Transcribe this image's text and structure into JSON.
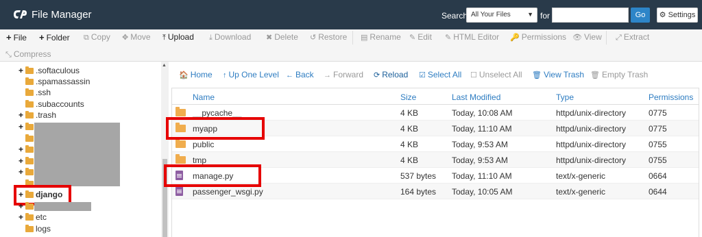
{
  "header": {
    "app_title": "File Manager",
    "search_label": "Search",
    "search_scope": "All Your Files",
    "for_label": "for",
    "search_value": "",
    "go_label": "Go",
    "settings_label": "Settings"
  },
  "toolbar": {
    "items": [
      {
        "label": "File",
        "icon": "+"
      },
      {
        "label": "Folder",
        "icon": "+"
      },
      {
        "label": "Copy",
        "icon": "⧉"
      },
      {
        "label": "Move",
        "icon": "✥"
      },
      {
        "label": "Upload",
        "icon": "⤒"
      },
      {
        "label": "Download",
        "icon": "⤓"
      },
      {
        "label": "Delete",
        "icon": "✖"
      },
      {
        "label": "Restore",
        "icon": "↺"
      },
      {
        "label": "Rename",
        "icon": "▤"
      },
      {
        "label": "Edit",
        "icon": "✎"
      },
      {
        "label": "HTML Editor",
        "icon": "✎"
      },
      {
        "label": "Permissions",
        "icon": "🔑"
      },
      {
        "label": "View",
        "icon": "👁"
      },
      {
        "label": "Extract",
        "icon": "⤢"
      },
      {
        "label": "Compress",
        "icon": "⤡"
      }
    ]
  },
  "tree": {
    "items": [
      {
        "label": ".softaculous"
      },
      {
        "label": ".spamassassin"
      },
      {
        "label": ".ssh"
      },
      {
        "label": ".subaccounts"
      },
      {
        "label": ".trash"
      },
      {
        "label": "django"
      },
      {
        "label": "etc"
      },
      {
        "label": "logs"
      }
    ]
  },
  "actions": {
    "home": "Home",
    "up": "Up One Level",
    "back": "Back",
    "forward": "Forward",
    "reload": "Reload",
    "select_all": "Select All",
    "unselect_all": "Unselect All",
    "view_trash": "View Trash",
    "empty_trash": "Empty Trash"
  },
  "table": {
    "headers": {
      "name": "Name",
      "size": "Size",
      "modified": "Last Modified",
      "type": "Type",
      "perms": "Permissions"
    },
    "rows": [
      {
        "name": "__pycache__",
        "size": "4 KB",
        "modified": "Today, 10:08 AM",
        "type": "httpd/unix-directory",
        "perms": "0775"
      },
      {
        "name": "myapp",
        "size": "4 KB",
        "modified": "Today, 11:10 AM",
        "type": "httpd/unix-directory",
        "perms": "0775"
      },
      {
        "name": "public",
        "size": "4 KB",
        "modified": "Today, 9:53 AM",
        "type": "httpd/unix-directory",
        "perms": "0755"
      },
      {
        "name": "tmp",
        "size": "4 KB",
        "modified": "Today, 9:53 AM",
        "type": "httpd/unix-directory",
        "perms": "0755"
      },
      {
        "name": "manage.py",
        "size": "537 bytes",
        "modified": "Today, 11:10 AM",
        "type": "text/x-generic",
        "perms": "0664"
      },
      {
        "name": "passenger_wsgi.py",
        "size": "164 bytes",
        "modified": "Today, 10:05 AM",
        "type": "text/x-generic",
        "perms": "0644"
      }
    ]
  }
}
